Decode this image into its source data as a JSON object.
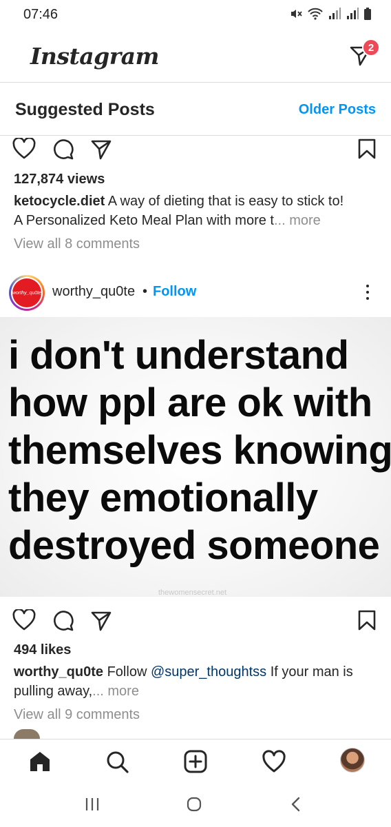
{
  "status_bar": {
    "time": "07:46"
  },
  "header": {
    "logo": "Instagram",
    "dm_badge": "2"
  },
  "sub_header": {
    "title": "Suggested Posts",
    "older_link": "Older Posts"
  },
  "post1": {
    "views": "127,874 views",
    "username": "ketocycle.diet",
    "caption_line1": "A way of dieting that is easy to stick to!",
    "caption_line2": "A Personalized Keto Meal Plan with more t",
    "ellipsis": "...",
    "more": "more",
    "comments": "View all 8 comments"
  },
  "post2": {
    "avatar_text": "worthy_qu0te",
    "username": "worthy_qu0te",
    "separator": "•",
    "follow": "Follow",
    "quote_lines": [
      "i don't understand",
      "how ppl are ok with",
      "themselves knowing",
      "they emotionally",
      "destroyed someone"
    ],
    "watermark": "thewomensecret.net",
    "likes": "494 likes",
    "caption_username": "worthy_qu0te",
    "caption_follow": "Follow",
    "caption_mention": "@super_thoughtss",
    "caption_rest": "If your man is",
    "caption_line2": "pulling away,",
    "ellipsis": "...",
    "more": "more",
    "comments": "View all 9 comments"
  },
  "icons": {
    "status": [
      "mute-icon",
      "wifi-icon",
      "signal-icon",
      "signal-icon",
      "battery-icon"
    ],
    "post_actions": [
      "heart-icon",
      "comment-icon",
      "share-icon",
      "bookmark-icon"
    ],
    "bottom_nav": [
      "home-icon",
      "search-icon",
      "add-post-icon",
      "activity-heart-icon",
      "profile-avatar"
    ],
    "system_nav": [
      "recent-apps-icon",
      "home-circle-icon",
      "back-icon"
    ]
  },
  "colors": {
    "link_blue": "#0095f6",
    "badge_red": "#ed4956",
    "text": "#262626",
    "grey": "#8e8e8e",
    "mention": "#00376b"
  }
}
